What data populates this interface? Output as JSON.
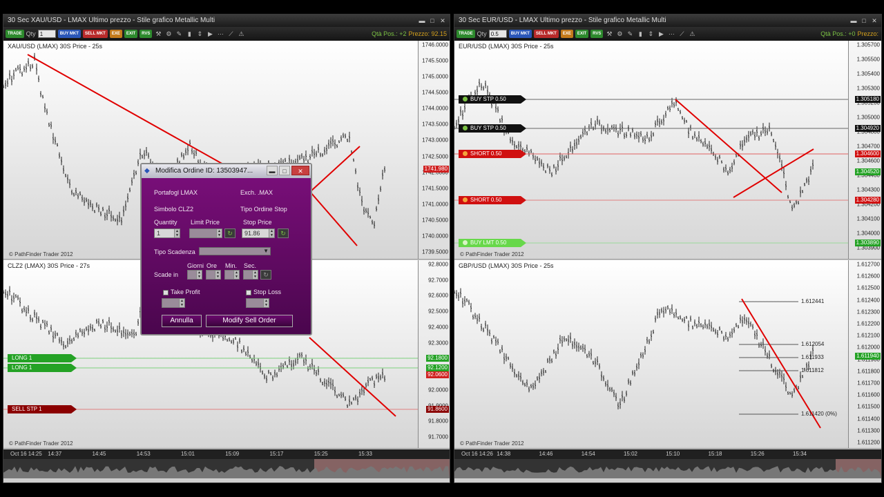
{
  "left_window": {
    "title": "30 Sec XAU/USD - LMAX Ultimo prezzo - Stile grafico Metallic Multi",
    "toolbar": {
      "trade": "TRADE",
      "qty_label": "Qty",
      "qty_value": "1",
      "buy_mkt": "BUY MKT",
      "sell_mkt": "SELL MKT",
      "exe": "EXE",
      "exit": "EXIT",
      "rvs": "RVS",
      "position": "Qtà Pos.: +2",
      "price": "Prezzo: 92.15"
    },
    "chart_top": {
      "label": "XAU/USD (LMAX) 30S Price - 25s",
      "copyright": "© PathFinder Trader 2012",
      "ticks": [
        "1746.0000",
        "1745.5000",
        "1745.0000",
        "1744.5000",
        "1744.0000",
        "1743.5000",
        "1743.0000",
        "1742.5000",
        "1742.0000",
        "1741.5000",
        "1741.0000",
        "1740.5000",
        "1740.0000",
        "1739.5000"
      ],
      "price_tag": "1741.980"
    },
    "chart_bottom": {
      "label": "CLZ2 (LMAX) 30S Price - 27s",
      "copyright": "© PathFinder Trader 2012",
      "ticks": [
        "92.8000",
        "92.7000",
        "92.6000",
        "92.5000",
        "92.4000",
        "92.3000",
        "92.2000",
        "92.1000",
        "92.0000",
        "91.9000",
        "91.8000",
        "91.7000"
      ],
      "orders": [
        {
          "label": "LONG 1",
          "tag": "92.1800"
        },
        {
          "label": "LONG 1",
          "tag": "92.1200"
        },
        {
          "label": "SELL STP 1",
          "tag": "91.8600"
        }
      ],
      "current_tag": "92.0600"
    },
    "xaxis": [
      "Oct 16 14:25",
      "14:37",
      "14:45",
      "14:53",
      "15:01",
      "15:09",
      "15:17",
      "15:25",
      "15:33"
    ]
  },
  "right_window": {
    "title": "30 Sec EUR/USD - LMAX Ultimo prezzo - Stile grafico Metallic Multi",
    "toolbar": {
      "trade": "TRADE",
      "qty_label": "Qty",
      "qty_value": "0.5",
      "buy_mkt": "BUY MKT",
      "sell_mkt": "SELL MKT",
      "exe": "EXE",
      "exit": "EXIT",
      "rvs": "RVS",
      "position": "Qtà Pos.: +0",
      "price": "Prezzo:"
    },
    "chart_top": {
      "label": "EUR/USD (LMAX) 30S Price - 25s",
      "copyright": "© PathFinder Trader 2012",
      "ticks": [
        "1.305700",
        "1.305500",
        "1.305400",
        "1.305300",
        "1.305200",
        "1.305000",
        "1.304800",
        "1.304700",
        "1.304600",
        "1.304400",
        "1.304300",
        "1.304200",
        "1.304100",
        "1.304000",
        "1.303900"
      ],
      "orders": [
        {
          "label": "BUY STP 0.50",
          "tag": "1.305180"
        },
        {
          "label": "BUY STP 0.50",
          "tag": "1.304920"
        },
        {
          "label": "SHORT 0.50",
          "tag": "1.304600"
        },
        {
          "label": "SHORT 0.50",
          "tag": "1.304280"
        },
        {
          "label": "BUY LMT 0.50",
          "tag": "1.303890"
        }
      ],
      "current_tag": "1.304520"
    },
    "chart_bottom": {
      "label": "GBP/USD (LMAX) 30S Price - 25s",
      "copyright": "© PathFinder Trader 2012",
      "ticks": [
        "1.612700",
        "1.612600",
        "1.612500",
        "1.612400",
        "1.612300",
        "1.612200",
        "1.612100",
        "1.612000",
        "1.611900",
        "1.611800",
        "1.611700",
        "1.611600",
        "1.611500",
        "1.611400",
        "1.611300",
        "1.611200"
      ],
      "fib_levels": [
        "1.612441",
        "1.612054",
        "1.611933",
        "1.611812",
        "1.611420 (0%)"
      ],
      "current_tag": "1.611940"
    },
    "xaxis": [
      "Oct 16 14:26",
      "14:38",
      "14:46",
      "14:54",
      "15:02",
      "15:10",
      "15:18",
      "15:26",
      "15:34"
    ]
  },
  "dialog": {
    "title": "Modifica Ordine ID: 13503947...",
    "portfolio_label": "Portafogl LMAX",
    "exchange_label": "Exch. .MAX",
    "symbol_label": "Simbolo CLZ2",
    "order_type_label": "Tipo Ordine Stop",
    "quantity_label": "Quantity",
    "quantity_value": "1",
    "limit_label": "Limit Price",
    "limit_value": "",
    "stop_label": "Stop Price",
    "stop_value": "91.86",
    "expiry_label": "Tipo Scadenza",
    "expires_label": "Scade in",
    "days_label": "Giorni",
    "hours_label": "Ore",
    "min_label": "Min.",
    "sec_label": "Sec.",
    "take_profit_label": "Take Profit",
    "stop_loss_label": "Stop Loss",
    "cancel_label": "Annulla",
    "submit_label": "Modify Sell Order"
  },
  "colors": {
    "accent": "#7a0f7a",
    "trend_line": "#e00000",
    "long": "#24a225",
    "short": "#d01010"
  }
}
